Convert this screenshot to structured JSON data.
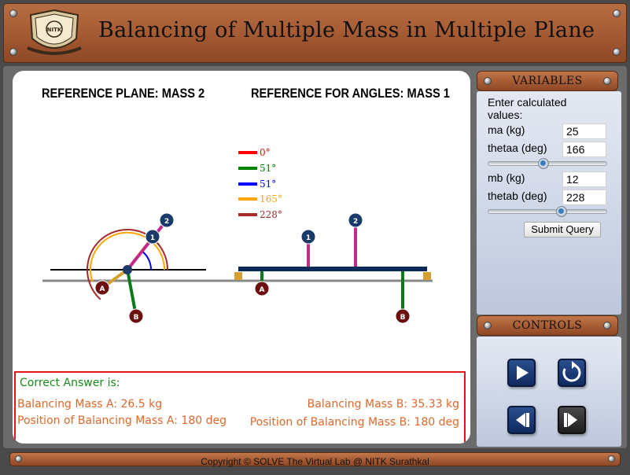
{
  "header": {
    "title": "Balancing of Multiple Mass in Multiple Plane",
    "logo_text": "NITK"
  },
  "reference": {
    "plane": "REFERENCE PLANE: MASS 2",
    "angles": "REFERENCE FOR ANGLES: MASS 1"
  },
  "legend": [
    {
      "label": "0°",
      "color": "#ff0000"
    },
    {
      "label": "51°",
      "color": "#008000"
    },
    {
      "label": "51°",
      "color": "#0000ff"
    },
    {
      "label": "165°",
      "color": "#ffa500"
    },
    {
      "label": "228°",
      "color": "#a52a2a"
    }
  ],
  "diagram": {
    "mass1_label": "1",
    "mass2_label": "2",
    "massA_label": "A",
    "massB_label": "B",
    "colors": {
      "mass_dark": "#1a3a6a",
      "balance_mass": "#6b0f0f",
      "rod1": "#c02a8a",
      "rodB": "#0a7a1a",
      "shaft": "#0a2a5a",
      "bearing": "#d4a030"
    }
  },
  "answer": {
    "title": "Correct Answer is:",
    "mass_a": "Balancing Mass A: 26.5 kg",
    "pos_a": "Position of Balancing Mass A: 180 deg",
    "mass_b": "Balancing Mass B: 35.33 kg",
    "pos_b": "Position of Balancing Mass B: 180 deg"
  },
  "variables": {
    "heading": "VARIABLES",
    "intro": "Enter calculated values:",
    "ma_label": "ma (kg)",
    "ma_value": "25",
    "thetaa_label": "thetaa (deg)",
    "thetaa_value": "166",
    "mb_label": "mb (kg)",
    "mb_value": "12",
    "thetab_label": "thetab (deg)",
    "thetab_value": "228",
    "thetaa_slider_fraction": 0.46,
    "thetab_slider_fraction": 0.63,
    "submit_label": "Submit Query"
  },
  "controls": {
    "heading": "CONTROLS",
    "buttons": [
      "play-icon",
      "reset-icon",
      "step-back-icon",
      "step-forward-icon"
    ]
  },
  "footer": {
    "copyright": "Copyright © SOLVE The Virtual Lab @ NITK Surathkal"
  }
}
